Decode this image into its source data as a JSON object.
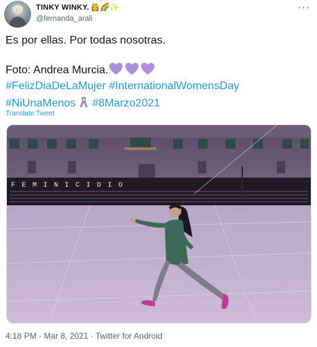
{
  "tweet": {
    "display_name": "TINKY WINKY.",
    "display_name_emojis": "👸🌈✨",
    "handle": "@fernanda_arali",
    "more_label": "···",
    "text_line1": "Es por ellas. Por todas nosotras.",
    "text_line2_prefix": "Foto: Andrea Murcia.",
    "hashtags_line3": [
      "#FelizDiaDeLaMujer",
      "#InternationalWomensDay"
    ],
    "hashtags_line4": [
      "#NiUnaMenos",
      "#8Marzo2021"
    ],
    "translate_label": "Translate Tweet",
    "photo_sign_text": "FEMINICIDIO",
    "timestamp": "4:18 PM · Mar 8, 2021 · Twitter for Android",
    "colors": {
      "hashtag": "#1d9bf0",
      "heart": "#b18ce0",
      "secondary_text": "#536471"
    },
    "icons": [
      "avatar",
      "more-icon",
      "purple-heart-icon",
      "ribbon-icon"
    ]
  }
}
